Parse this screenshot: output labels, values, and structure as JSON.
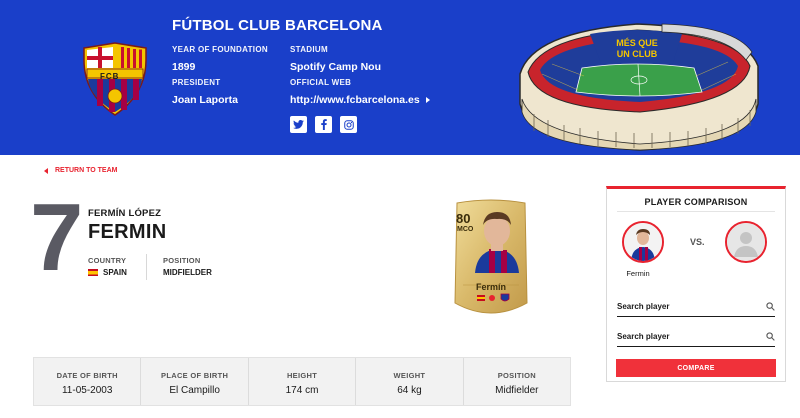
{
  "club": {
    "name": "FÚTBOL CLUB BARCELONA",
    "crest_text": "FCB",
    "foundation_label": "YEAR OF FOUNDATION",
    "foundation_value": "1899",
    "stadium_label": "STADIUM",
    "stadium_value": "Spotify Camp Nou",
    "president_label": "PRESIDENT",
    "president_value": "Joan Laporta",
    "web_label": "OFFICIAL WEB",
    "web_value": "http://www.fcbarcelona.es",
    "stadium_banner_text": [
      "MÉS QUE",
      "UN CLUB"
    ],
    "socials": [
      "twitter-icon",
      "facebook-icon",
      "instagram-icon"
    ]
  },
  "nav": {
    "return_label": "RETURN TO TEAM"
  },
  "player": {
    "number": "7",
    "first_name": "FERMÍN LÓPEZ",
    "last_name": "FERMIN",
    "country_label": "COUNTRY",
    "country_value": "SPAIN",
    "position_label": "POSITION",
    "position_value": "MIDFIELDER"
  },
  "card": {
    "rating": "80",
    "position": "MCO",
    "name": "Fermín"
  },
  "stats": [
    {
      "label": "DATE OF BIRTH",
      "value": "11-05-2003"
    },
    {
      "label": "PLACE OF BIRTH",
      "value": "El Campillo"
    },
    {
      "label": "HEIGHT",
      "value": "174 cm"
    },
    {
      "label": "WEIGHT",
      "value": "64 kg"
    },
    {
      "label": "POSITION",
      "value": "Midfielder"
    }
  ],
  "comparison": {
    "title": "PLAYER COMPARISON",
    "vs_label": "VS.",
    "player_name": "Fermin",
    "search1_label": "Search player",
    "search2_label": "Search player",
    "button_label": "COMPARE"
  },
  "colors": {
    "header_blue": "#1a3fc9",
    "accent_red": "#e8232f",
    "card_gold": "#d9b96a"
  }
}
